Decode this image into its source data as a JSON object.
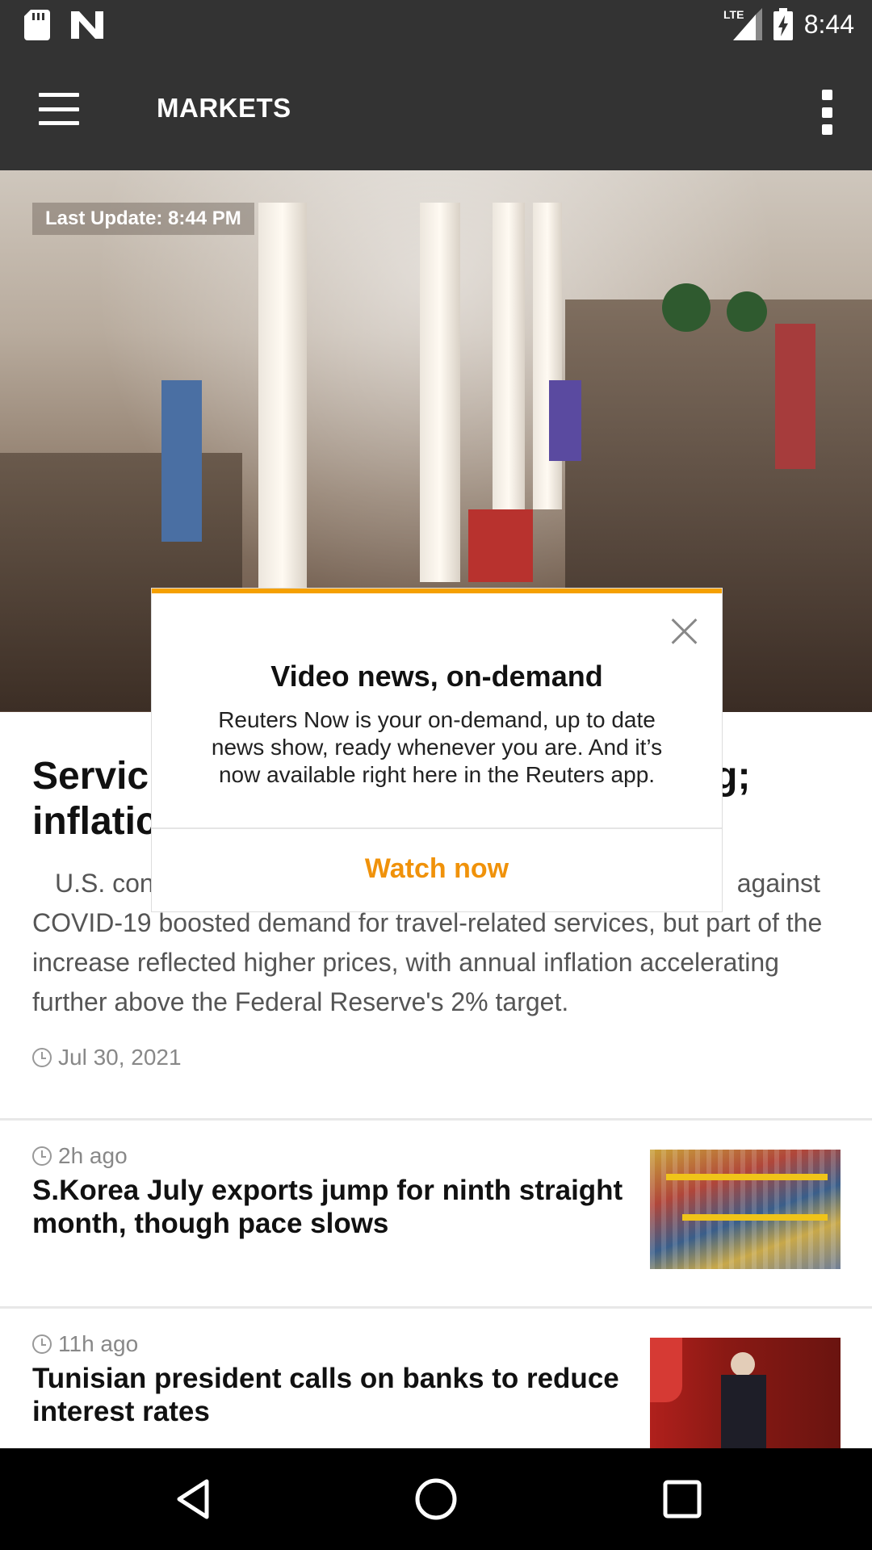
{
  "status_bar": {
    "time": "8:44",
    "network": "LTE",
    "icons": [
      "sd-card-icon",
      "n-app-icon",
      "signal-icon",
      "battery-charging-icon"
    ]
  },
  "app_bar": {
    "title": "MARKETS"
  },
  "hero": {
    "last_update": "Last Update: 8:44 PM"
  },
  "article": {
    "title": "Services spending surges; inflation heating up",
    "title_visible_left": "Servic",
    "title_visible_left_2": "inflatic",
    "title_visible_right": "g;",
    "summary_line1_left": "U.S. con",
    "summary_line1_right": "against",
    "summary_rest": "COVID-19 boosted demand for travel-related services, but part of the increase reflected higher prices, with annual inflation accelerating further above the Federal Reserve's 2% target.",
    "date": "Jul 30, 2021"
  },
  "stories": [
    {
      "time": "2h ago",
      "title": "S.Korea July exports jump for ninth straight month, though pace slows"
    },
    {
      "time": "11h ago",
      "title": "Tunisian president calls on banks to reduce interest rates"
    }
  ],
  "dialog": {
    "title": "Video news, on-demand",
    "body": "Reuters Now is your on-demand, up to date news show, ready whenever you are. And it’s now available right here in the Reuters app.",
    "action": "Watch now",
    "accent": "#f5a000"
  }
}
